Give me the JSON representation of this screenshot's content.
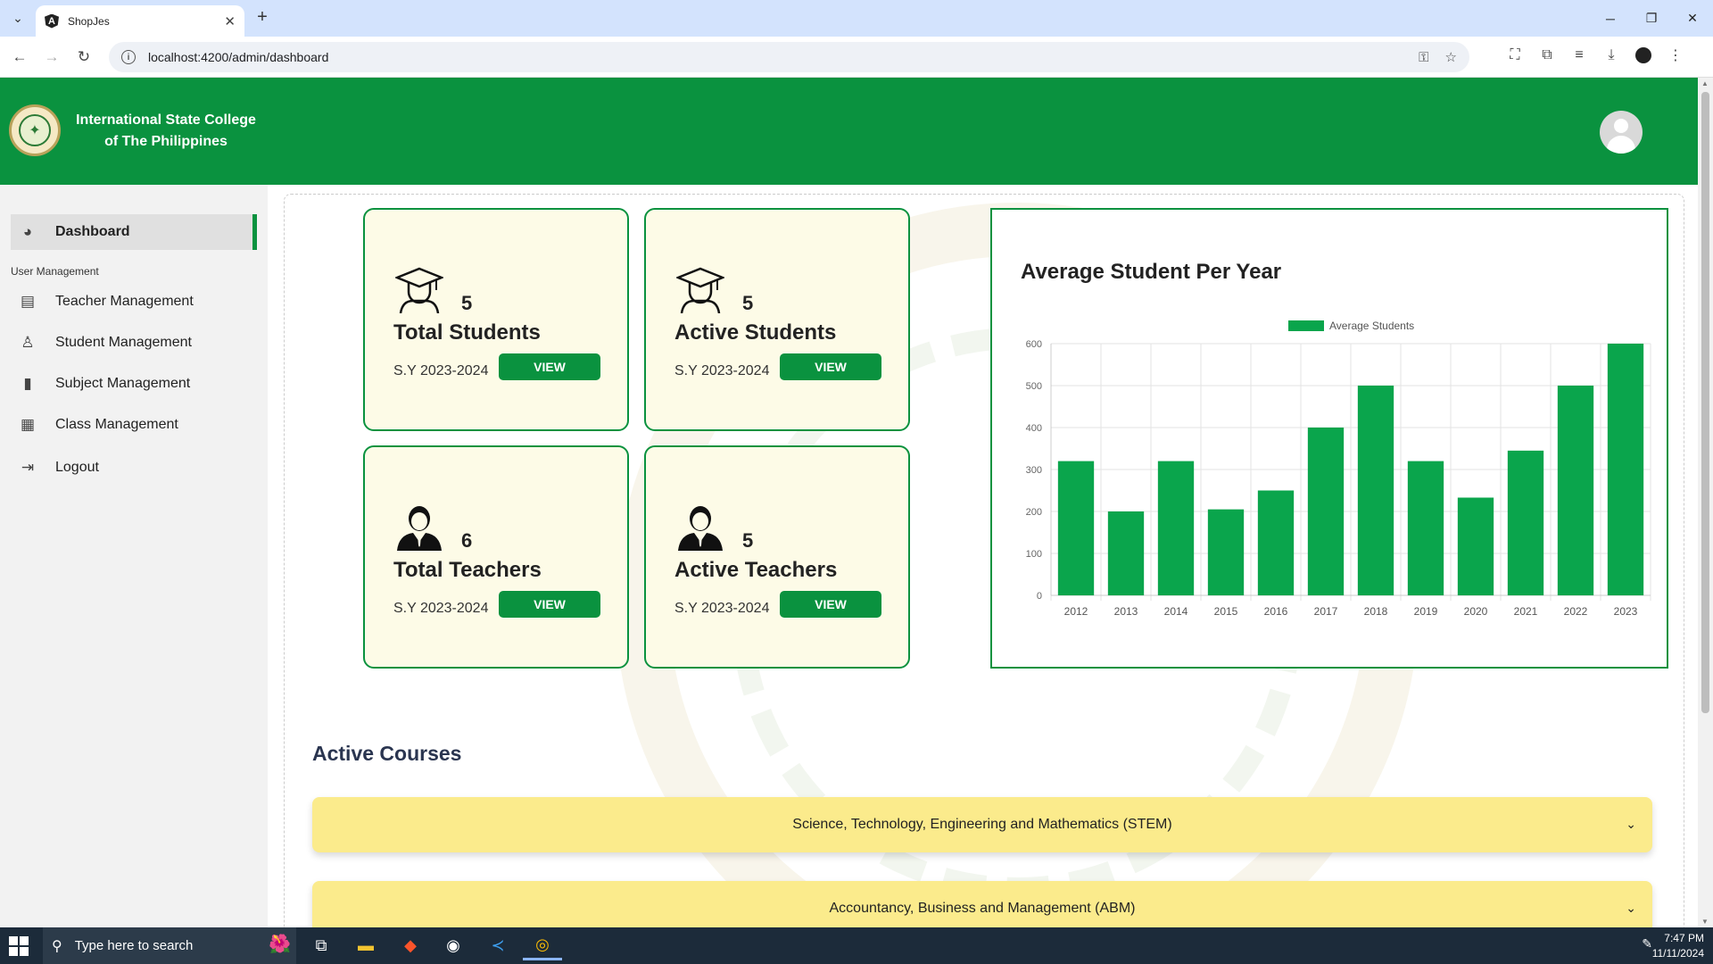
{
  "browser": {
    "tab_title": "ShopJes",
    "url": "localhost:4200/admin/dashboard"
  },
  "header": {
    "school_name_line1": "International State College",
    "school_name_line2": "of The Philippines"
  },
  "sidebar": {
    "dashboard": "Dashboard",
    "section_label": "User Management",
    "items": [
      {
        "label": "Teacher Management",
        "icon": "id-card-icon"
      },
      {
        "label": "Student Management",
        "icon": "user-icon"
      },
      {
        "label": "Subject Management",
        "icon": "book-icon"
      },
      {
        "label": "Class Management",
        "icon": "calendar-icon"
      },
      {
        "label": "Logout",
        "icon": "logout-icon"
      }
    ]
  },
  "cards": [
    {
      "count": "5",
      "label": "Total Students",
      "sy": "S.Y 2023-2024",
      "button": "VIEW",
      "icon": "graduate-icon"
    },
    {
      "count": "5",
      "label": "Active Students",
      "sy": "S.Y 2023-2024",
      "button": "VIEW",
      "icon": "graduate-icon"
    },
    {
      "count": "6",
      "label": "Total Teachers",
      "sy": "S.Y 2023-2024",
      "button": "VIEW",
      "icon": "teacher-icon"
    },
    {
      "count": "5",
      "label": "Active Teachers",
      "sy": "S.Y 2023-2024",
      "button": "VIEW",
      "icon": "teacher-icon"
    }
  ],
  "chart_data": {
    "type": "bar",
    "title": "Average Student Per Year",
    "categories": [
      "2012",
      "2013",
      "2014",
      "2015",
      "2016",
      "2017",
      "2018",
      "2019",
      "2020",
      "2021",
      "2022",
      "2023"
    ],
    "series": [
      {
        "name": "Average Students",
        "values": [
          320,
          200,
          320,
          205,
          250,
          400,
          500,
          320,
          233,
          345,
          500,
          600
        ],
        "color": "#0aa54c"
      }
    ],
    "ylim": [
      0,
      600
    ],
    "yticks": [
      0,
      100,
      200,
      300,
      400,
      500,
      600
    ],
    "grid": true,
    "legend": "top-center"
  },
  "courses": {
    "title": "Active Courses",
    "items": [
      "Science, Technology, Engineering and Mathematics (STEM)",
      "Accountancy, Business and Management (ABM)"
    ]
  },
  "taskbar": {
    "search_placeholder": "Type here to search",
    "time": "7:47 PM",
    "date": "11/11/2024"
  },
  "colors": {
    "brand_green": "#0a923f",
    "card_bg": "#fdfbe7",
    "accordion_bg": "#fbeb8c"
  }
}
